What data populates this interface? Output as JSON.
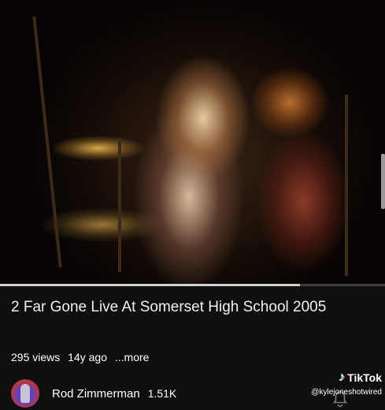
{
  "video": {
    "progress": 0.78,
    "colors": {
      "track": "#3d3d3d",
      "fill": "#cfcfcf"
    }
  },
  "meta": {
    "title": "2 Far Gone Live At Somerset High School 2005",
    "views": "295 views",
    "age": "14y ago",
    "more": "...more"
  },
  "channel": {
    "name": "Rod Zimmerman",
    "subscribers": "1.51K"
  },
  "overlay": {
    "brand": "TikTok",
    "handle": "@kylejoneshotwired",
    "brand_icon": "tiktok-logo-icon"
  },
  "icons": {
    "bell": "bell-icon",
    "avatar": "channel-avatar"
  }
}
